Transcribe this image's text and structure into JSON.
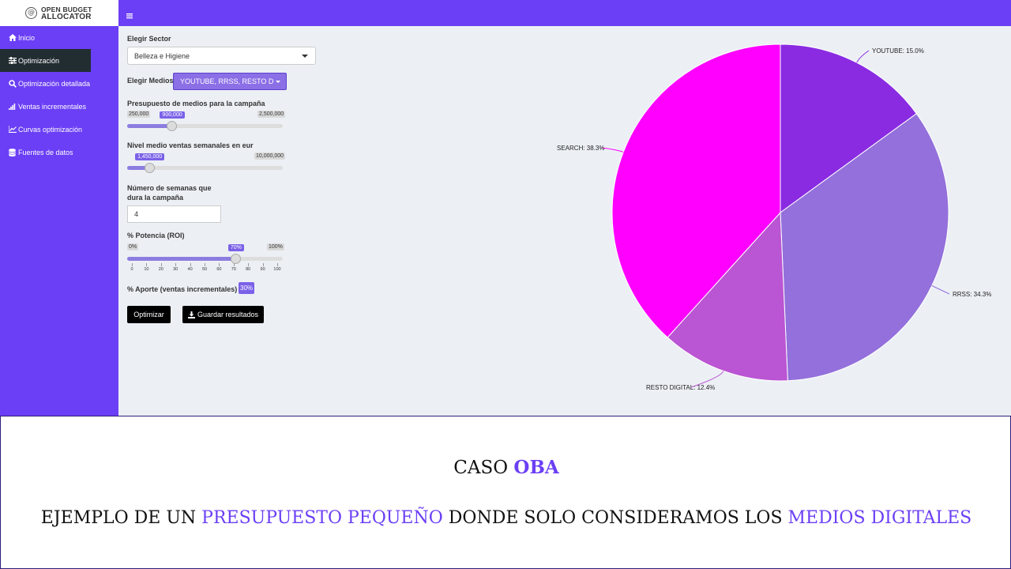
{
  "logo": {
    "line1": "OPEN BUDGET",
    "line2": "ALLOCATOR",
    "mark": "@"
  },
  "sidebar": {
    "items": [
      {
        "label": "Inicio",
        "icon": "home-icon"
      },
      {
        "label": "Optimización",
        "icon": "sliders-icon",
        "active": true
      },
      {
        "label": "Optimización detallada",
        "icon": "search-icon"
      },
      {
        "label": "Ventas incrementales",
        "icon": "signal-bars-icon"
      },
      {
        "label": "Curvas optimización",
        "icon": "line-chart-icon"
      },
      {
        "label": "Fuentes de datos",
        "icon": "database-icon"
      }
    ]
  },
  "form": {
    "sector_label": "Elegir Sector",
    "sector_value": "Belleza e Higiene",
    "medios_label": "Elegir Medios:",
    "medios_value": "YOUTUBE, RRSS, RESTO DIGITAL",
    "budget": {
      "label": "Presupuesto de medios para la campaña",
      "min": "250,000",
      "max": "2,500,000",
      "value": "900,000",
      "fraction": 0.289
    },
    "sales": {
      "label": "Nivel medio ventas semanales en eur",
      "min": "1,450,000",
      "max": "10,000,000",
      "value": "1,450,000",
      "fraction": 0.145
    },
    "weeks": {
      "label_line1": "Número de semanas que",
      "label_line2": "dura la campaña",
      "value": "4"
    },
    "roi": {
      "label": "% Potencia (ROI)",
      "min": "0%",
      "max": "100%",
      "value": "70%",
      "fraction": 0.7,
      "ticks": [
        "0",
        "10",
        "20",
        "30",
        "40",
        "50",
        "60",
        "70",
        "80",
        "90",
        "100"
      ]
    },
    "aporte_label": "% Aporte (ventas incrementales) =",
    "aporte_value": "30%",
    "optimize_button": "Optimizar",
    "save_button": "Guardar resultados"
  },
  "chart_data": {
    "type": "pie",
    "slices": [
      {
        "label": "YOUTUBE: 15.0%",
        "name": "YOUTUBE",
        "value": 15.0,
        "color": "#8a2be2"
      },
      {
        "label": "RRSS: 34.3%",
        "name": "RRSS",
        "value": 34.3,
        "color": "#9370db"
      },
      {
        "label": "RESTO DIGITAL: 12.4%",
        "name": "RESTO DIGITAL",
        "value": 12.4,
        "color": "#ba55d3"
      },
      {
        "label": "SEARCH: 38.3%",
        "name": "SEARCH",
        "value": 38.3,
        "color": "#ff00ff"
      }
    ],
    "start_angle": "12 o'clock",
    "direction": "clockwise"
  },
  "caption": {
    "line1_a": "CASO ",
    "line1_b": "OBA",
    "line2_a": "EJEMPLO DE UN ",
    "line2_b": "PRESUPUESTO PEQUEÑO",
    "line2_c": " DONDE SOLO CONSIDERAMOS LOS ",
    "line2_d": "MEDIOS DIGITALES"
  },
  "colors": {
    "brand": "#6b3ff5",
    "sidebar_active": "#222d32",
    "content_bg": "#ecf0f5",
    "slider_accent": "#7b61e8"
  }
}
